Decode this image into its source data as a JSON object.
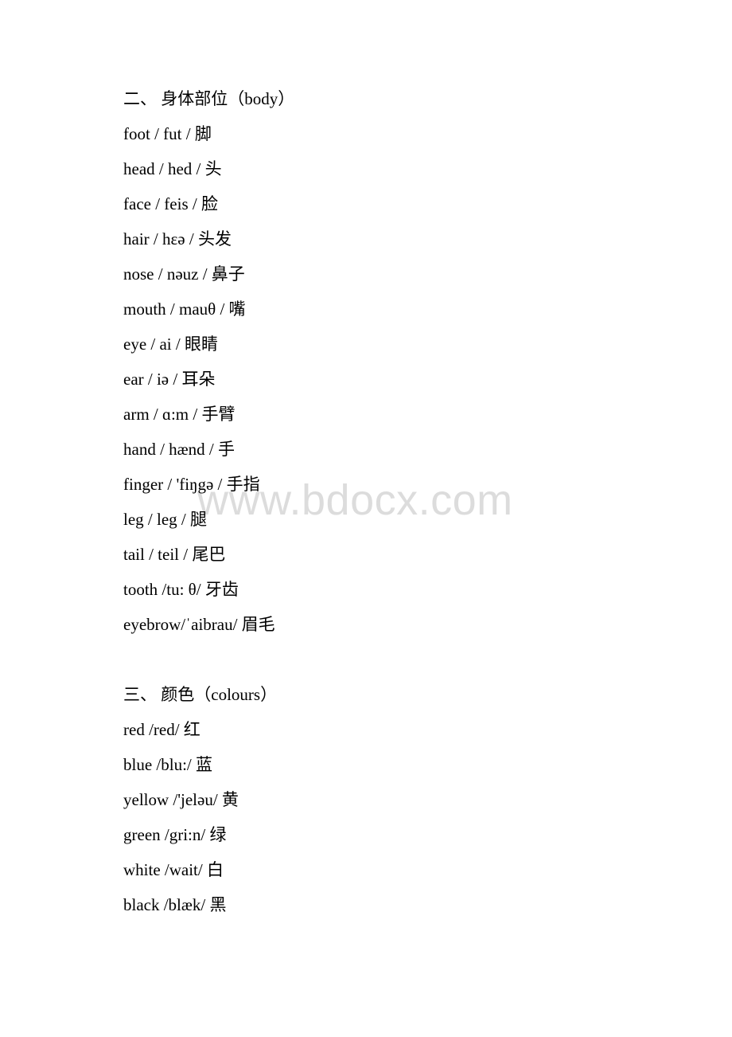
{
  "page": {
    "background_color": "#ffffff",
    "text_color": "#000000"
  },
  "watermark": {
    "text": "www.bdocx.com",
    "color": "#dcdcdc"
  },
  "sections": [
    {
      "heading": "二、 身体部位（body）",
      "entries": [
        {
          "text": "foot / fut / 脚"
        },
        {
          "text": "head / hed / 头"
        },
        {
          "text": "face / feis / 脸"
        },
        {
          "text": "hair / hɛə / 头发"
        },
        {
          "text": "nose / nəuz / 鼻子"
        },
        {
          "text": "mouth / mauθ / 嘴"
        },
        {
          "text": "eye / ai / 眼睛"
        },
        {
          "text": "ear / iə / 耳朵"
        },
        {
          "text": "arm / ɑ:m / 手臂"
        },
        {
          "text": "hand / hænd / 手"
        },
        {
          "text": "finger / 'fiŋgə / 手指"
        },
        {
          "text": "leg / leg / 腿"
        },
        {
          "text": "tail / teil / 尾巴"
        },
        {
          "text": "tooth /tu: θ/ 牙齿"
        },
        {
          "text": "eyebrow/ˈaibrau/ 眉毛"
        }
      ]
    },
    {
      "heading": "三、 颜色（colours）",
      "entries": [
        {
          "text": "red /red/ 红"
        },
        {
          "text": "blue /blu:/ 蓝"
        },
        {
          "text": "yellow /'jeləu/ 黄"
        },
        {
          "text": "green /gri:n/ 绿"
        },
        {
          "text": "white /wait/ 白"
        },
        {
          "text": "black /blæk/ 黑"
        }
      ]
    }
  ]
}
